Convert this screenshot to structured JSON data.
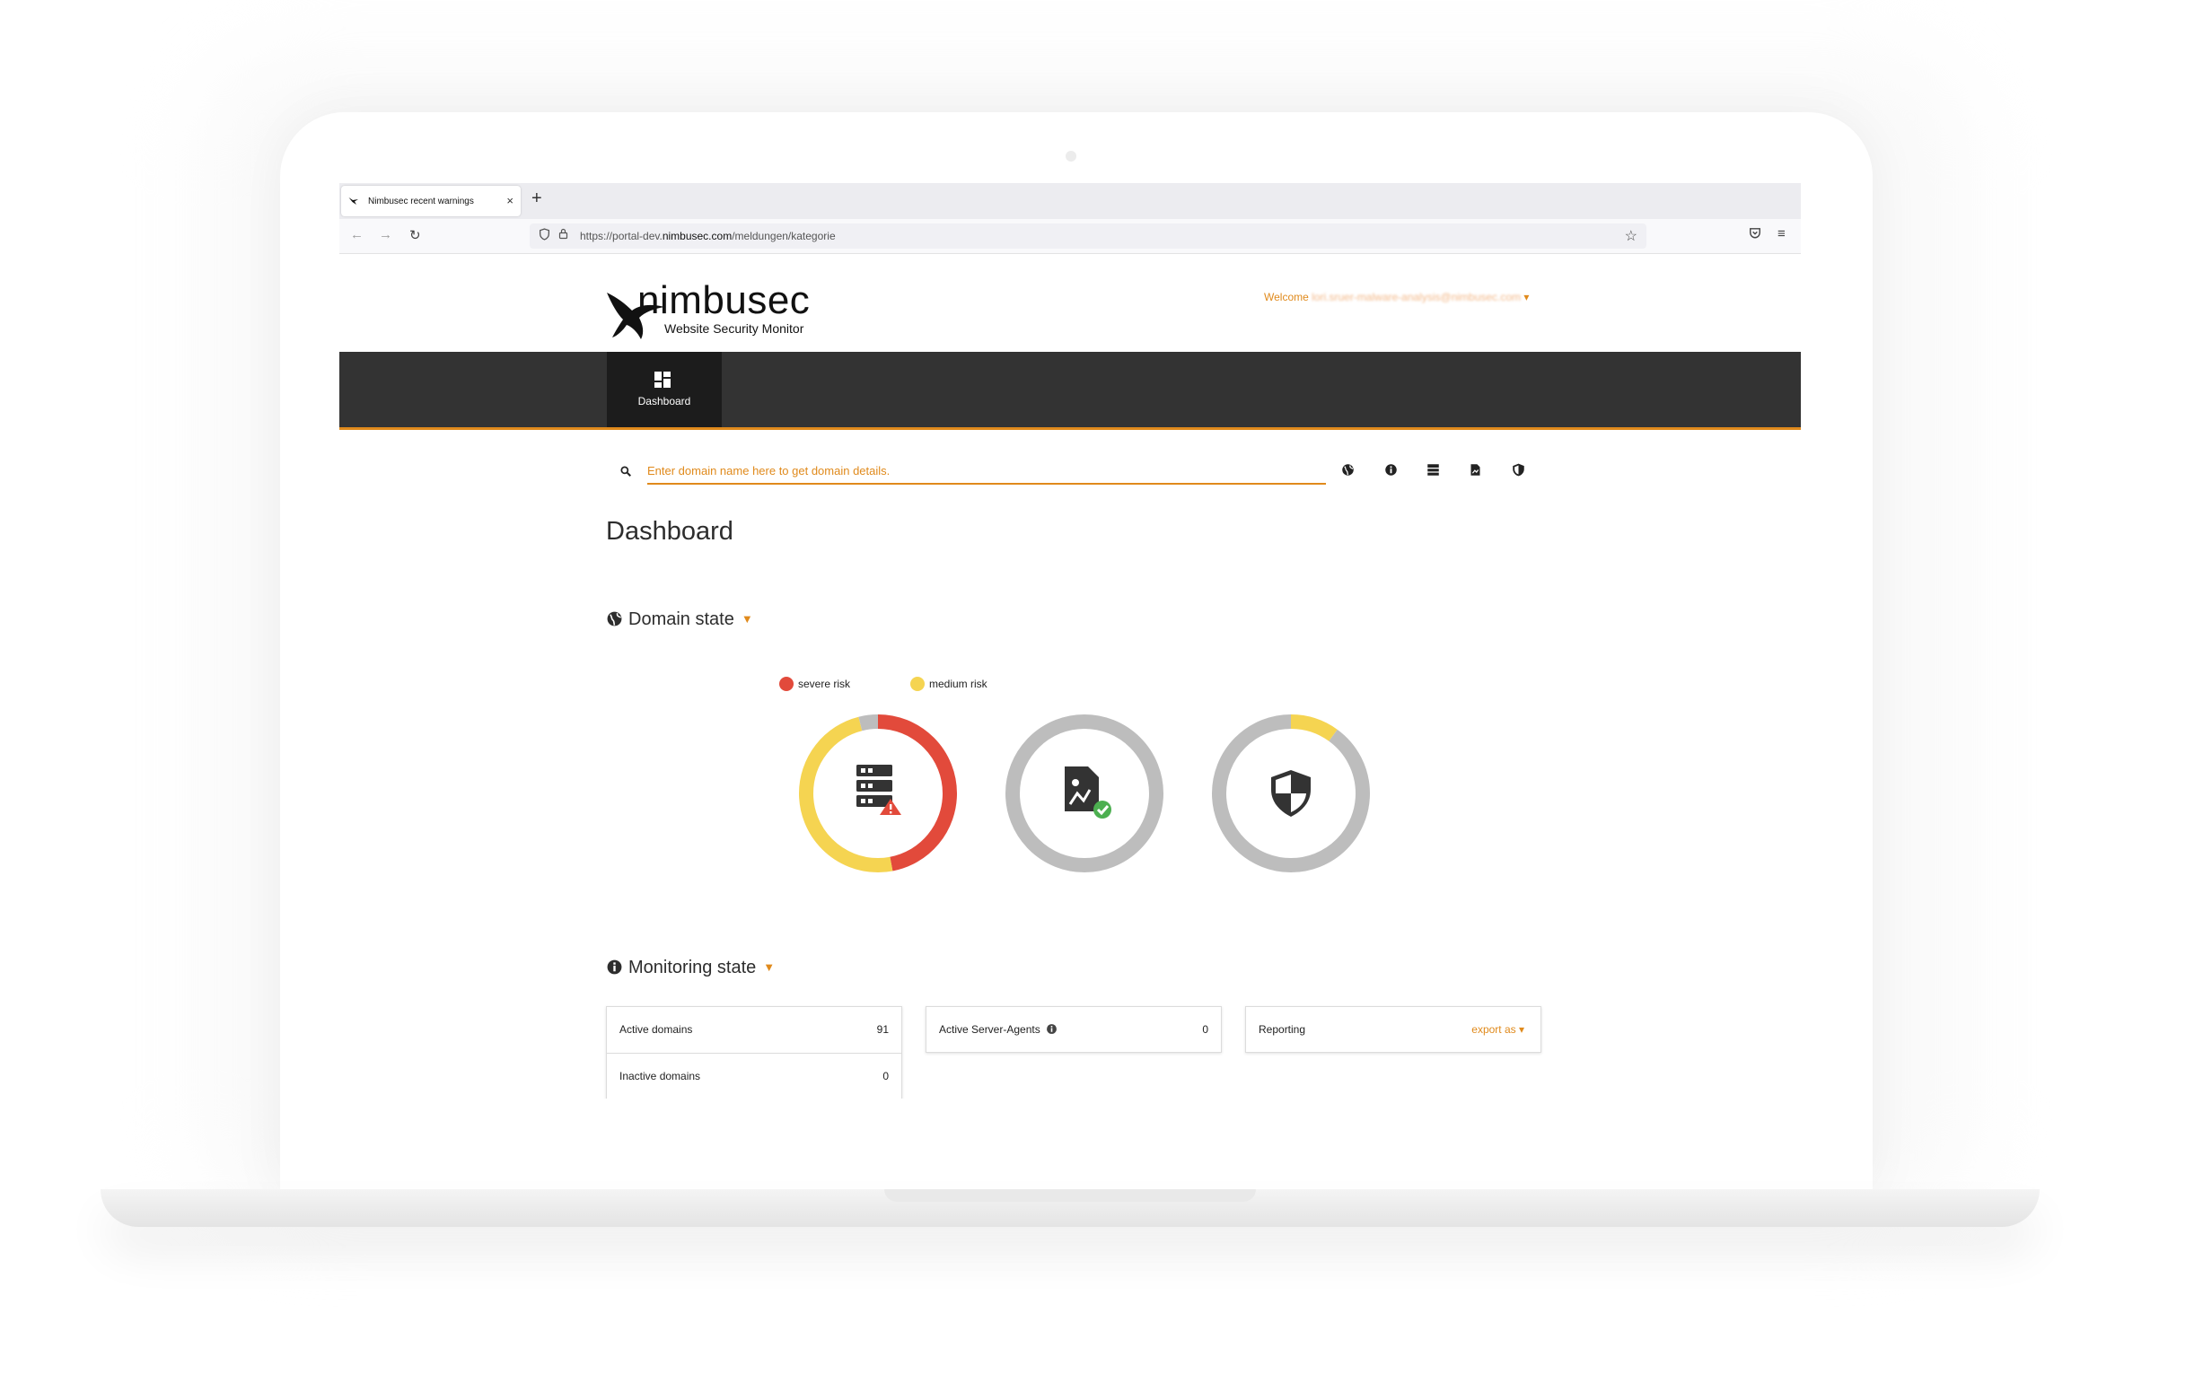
{
  "browser": {
    "tab_title": "Nimbusec recent warnings",
    "tab_close": "×",
    "new_tab": "+",
    "url_prefix": "https://portal-dev.",
    "url_domain": "nimbusec.com",
    "url_path": "/meldungen/kategorie"
  },
  "header": {
    "logo_word": "nimbusec",
    "logo_sub": "Website Security Monitor",
    "welcome": "Welcome",
    "email_blurred": "lori.sruer-malware-analysis@nimbusec.com",
    "caret": "▾"
  },
  "nav": {
    "dashboard": "Dashboard"
  },
  "search": {
    "placeholder": "Enter domain name here to get domain details."
  },
  "page": {
    "title": "Dashboard"
  },
  "domain_state": {
    "title": "Domain state",
    "legend": [
      {
        "label": "severe risk",
        "color": "#e24a3b"
      },
      {
        "label": "medium risk",
        "color": "#f5d451"
      }
    ],
    "donuts": [
      {
        "name": "server-warning",
        "segments": [
          {
            "color": "#e24a3b",
            "fraction": 0.47
          },
          {
            "color": "#f5d451",
            "fraction": 0.49
          },
          {
            "color": "#bdbdbd",
            "fraction": 0.04
          }
        ]
      },
      {
        "name": "image-check",
        "segments": [
          {
            "color": "#bdbdbd",
            "fraction": 1.0
          }
        ]
      },
      {
        "name": "shield",
        "segments": [
          {
            "color": "#f5d451",
            "fraction": 0.1
          },
          {
            "color": "#bdbdbd",
            "fraction": 0.9
          }
        ]
      }
    ]
  },
  "monitoring_state": {
    "title": "Monitoring state",
    "domains": [
      {
        "label": "Active domains",
        "value": "91"
      },
      {
        "label": "Inactive domains",
        "value": "0"
      }
    ],
    "agents": {
      "label": "Active Server-Agents",
      "value": "0"
    },
    "reporting": {
      "label": "Reporting",
      "export": "export as"
    }
  },
  "colors": {
    "accent": "#e08a1c",
    "nav_bg": "#333333",
    "nav_active": "#1c1c1c"
  }
}
